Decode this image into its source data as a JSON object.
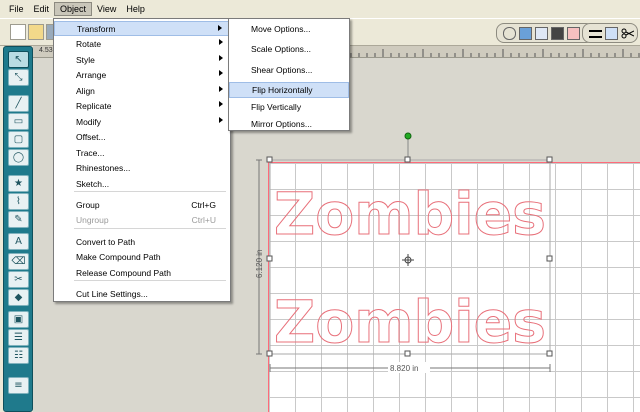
{
  "menubar": [
    "File",
    "Edit",
    "Object",
    "View",
    "Help"
  ],
  "active_menu": "Object",
  "object_menu": {
    "items": [
      {
        "label": "Transform",
        "submenu": true,
        "highlighted": true
      },
      {
        "label": "Rotate",
        "submenu": true
      },
      {
        "label": "Style",
        "submenu": true
      },
      {
        "label": "Arrange",
        "submenu": true
      },
      {
        "label": "Align",
        "submenu": true
      },
      {
        "label": "Replicate",
        "submenu": true
      },
      {
        "label": "Modify",
        "submenu": true
      },
      {
        "label": "Offset..."
      },
      {
        "label": "Trace..."
      },
      {
        "label": "Rhinestones..."
      },
      {
        "label": "Sketch..."
      },
      {
        "label": "Group",
        "shortcut": "Ctrl+G"
      },
      {
        "label": "Ungroup",
        "shortcut": "Ctrl+U",
        "disabled": true
      },
      {
        "label": "Convert to Path"
      },
      {
        "label": "Make Compound Path"
      },
      {
        "label": "Release Compound Path"
      },
      {
        "label": "Cut Line Settings..."
      }
    ]
  },
  "transform_menu": {
    "items": [
      {
        "label": "Move Options..."
      },
      {
        "label": "Scale Options..."
      },
      {
        "label": "Shear Options..."
      },
      {
        "label": "Flip Horizontally",
        "highlighted": true
      },
      {
        "label": "Flip Vertically"
      },
      {
        "label": "Mirror Options..."
      }
    ]
  },
  "ruler_label": "4.53",
  "canvas": {
    "artwork_text_top": "Zombies",
    "artwork_text_bottom": "Zombies",
    "height_dimension": "6.120 in",
    "width_dimension": "8.820 in",
    "cut_line_color": "#e8707a",
    "selection_handle_color": "#22aa22"
  },
  "tools": [
    "select-arrow-icon",
    "node-edit-icon",
    "line-icon",
    "rectangle-icon",
    "rounded-rectangle-icon",
    "ellipse-icon",
    "polygon-icon",
    "bezier-icon",
    "freehand-icon",
    "text-icon",
    "eraser-icon",
    "knife-icon",
    "fill-icon",
    "page-view-icon",
    "library-icon",
    "store-icon",
    "layers-icon"
  ]
}
